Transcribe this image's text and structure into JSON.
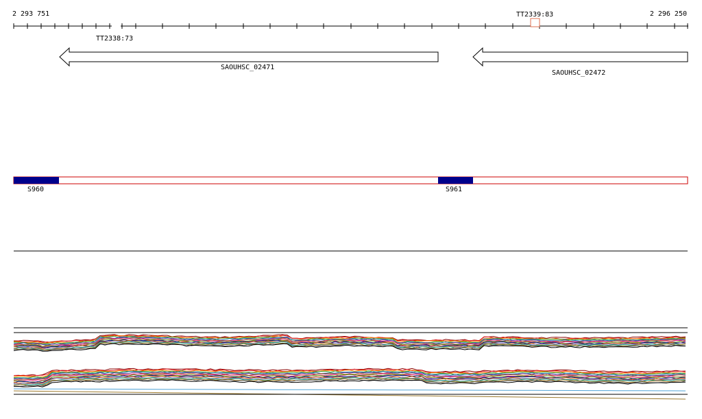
{
  "ruler": {
    "start_label": "2 293 751",
    "end_label": "2 296 250",
    "terminators": [
      {
        "label": "TT2338:73",
        "color": "#000000"
      },
      {
        "label": "TT2339:83",
        "color": "#e07050"
      }
    ]
  },
  "genes": [
    {
      "label": "SAOUHSC_02471",
      "strand": "-"
    },
    {
      "label": "SAOUHSC_02472",
      "strand": "-"
    }
  ],
  "segments": [
    {
      "label": "S960",
      "fill": "#00008b"
    },
    {
      "label": "S961",
      "fill": "#00008b"
    }
  ],
  "segment_track": {
    "outline_color": "#cc0000"
  },
  "expression": {
    "series_colors": [
      "#8b0000",
      "#e31a1c",
      "#ff7f00",
      "#33a02c",
      "#1f78b4",
      "#6a3d9a",
      "#b15928",
      "#e7298a",
      "#66a61e",
      "#000080",
      "#d95f02",
      "#7570b3",
      "#1b9e77",
      "#a6761d",
      "#666666",
      "#000000"
    ],
    "extra_line_colors": [
      "#4fa3d6",
      "#9c7a2e"
    ]
  }
}
